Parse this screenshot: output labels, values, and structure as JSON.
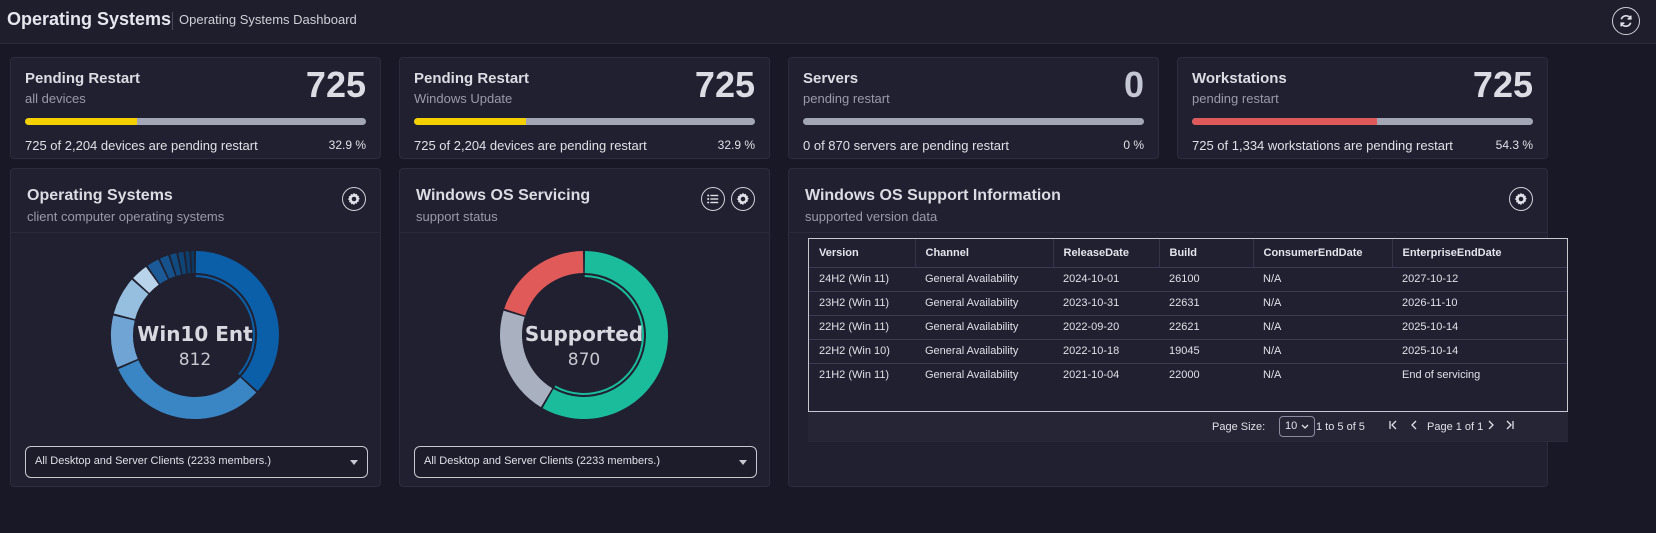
{
  "header": {
    "title": "Operating Systems",
    "subtitle": "Operating Systems Dashboard",
    "refresh_icon": "refresh-icon"
  },
  "kpis": [
    {
      "title": "Pending Restart",
      "subtitle": "all devices",
      "value": "725",
      "text": "725 of 2,204 devices are pending restart",
      "percent": "32.9 %",
      "fill_fraction": 0.329,
      "color": "#f5d000"
    },
    {
      "title": "Pending Restart",
      "subtitle": "Windows Update",
      "value": "725",
      "text": "725 of 2,204 devices are pending restart",
      "percent": "32.9 %",
      "fill_fraction": 0.329,
      "color": "#f5d000"
    },
    {
      "title": "Servers",
      "subtitle": "pending restart",
      "value": "0",
      "text": "0 of 870 servers are pending restart",
      "percent": "0 %",
      "fill_fraction": 0,
      "color": "#f5d000"
    },
    {
      "title": "Workstations",
      "subtitle": "pending restart",
      "value": "725",
      "text": "725 of 1,334 workstations are pending restart",
      "percent": "54.3 %",
      "fill_fraction": 0.543,
      "color": "#de5a5a"
    }
  ],
  "os_panel": {
    "title": "Operating Systems",
    "subtitle": "client computer operating systems",
    "center_label": "Win10 Ent",
    "center_value": "812",
    "select_value": "All Desktop and Server Clients (2233 members.)",
    "icons": [
      "gear-icon"
    ]
  },
  "servicing_panel": {
    "title": "Windows OS Servicing",
    "subtitle": "support status",
    "center_label": "Supported",
    "center_value": "870",
    "select_value": "All Desktop and Server Clients (2233 members.)",
    "icons": [
      "list-icon",
      "gear-icon"
    ]
  },
  "support_panel": {
    "title": "Windows OS Support Information",
    "subtitle": "supported version data",
    "columns": [
      "Version",
      "Channel",
      "ReleaseDate",
      "Build",
      "ConsumerEndDate",
      "EnterpriseEndDate"
    ],
    "rows": [
      [
        "24H2 (Win 11)",
        "General Availability",
        "2024-10-01",
        "26100",
        "N/A",
        "2027-10-12"
      ],
      [
        "23H2 (Win 11)",
        "General Availability",
        "2023-10-31",
        "22631",
        "N/A",
        "2026-11-10"
      ],
      [
        "22H2 (Win 11)",
        "General Availability",
        "2022-09-20",
        "22621",
        "N/A",
        "2025-10-14"
      ],
      [
        "22H2 (Win 10)",
        "General Availability",
        "2022-10-18",
        "19045",
        "N/A",
        "2025-10-14"
      ],
      [
        "21H2 (Win 11)",
        "General Availability",
        "2021-10-04",
        "22000",
        "N/A",
        "End of servicing"
      ]
    ],
    "pager": {
      "page_size_label": "Page Size:",
      "page_size": "10",
      "range": "1 to 5 of 5",
      "page_text": "Page 1 of 1"
    }
  },
  "chart_data": [
    {
      "type": "pie",
      "series": [
        {
          "values": [
            812,
            700,
            230,
            170,
            80,
            60,
            45,
            35,
            30,
            25,
            20
          ]
        }
      ],
      "colors": [
        "#0b5fa8",
        "#3a86c4",
        "#6fa4d4",
        "#96bede",
        "#b9d4ea",
        "#1b5a96",
        "#15528b",
        "#114a7f",
        "#0f4476",
        "#0d3e6c",
        "#0b3860"
      ]
    },
    {
      "type": "pie",
      "categories": [
        "Supported"
      ],
      "series": [
        {
          "values": [
            870,
            320,
            300
          ]
        }
      ],
      "colors": [
        "#1abc9c",
        "#a9b0bf",
        "#e05a5a"
      ]
    }
  ]
}
